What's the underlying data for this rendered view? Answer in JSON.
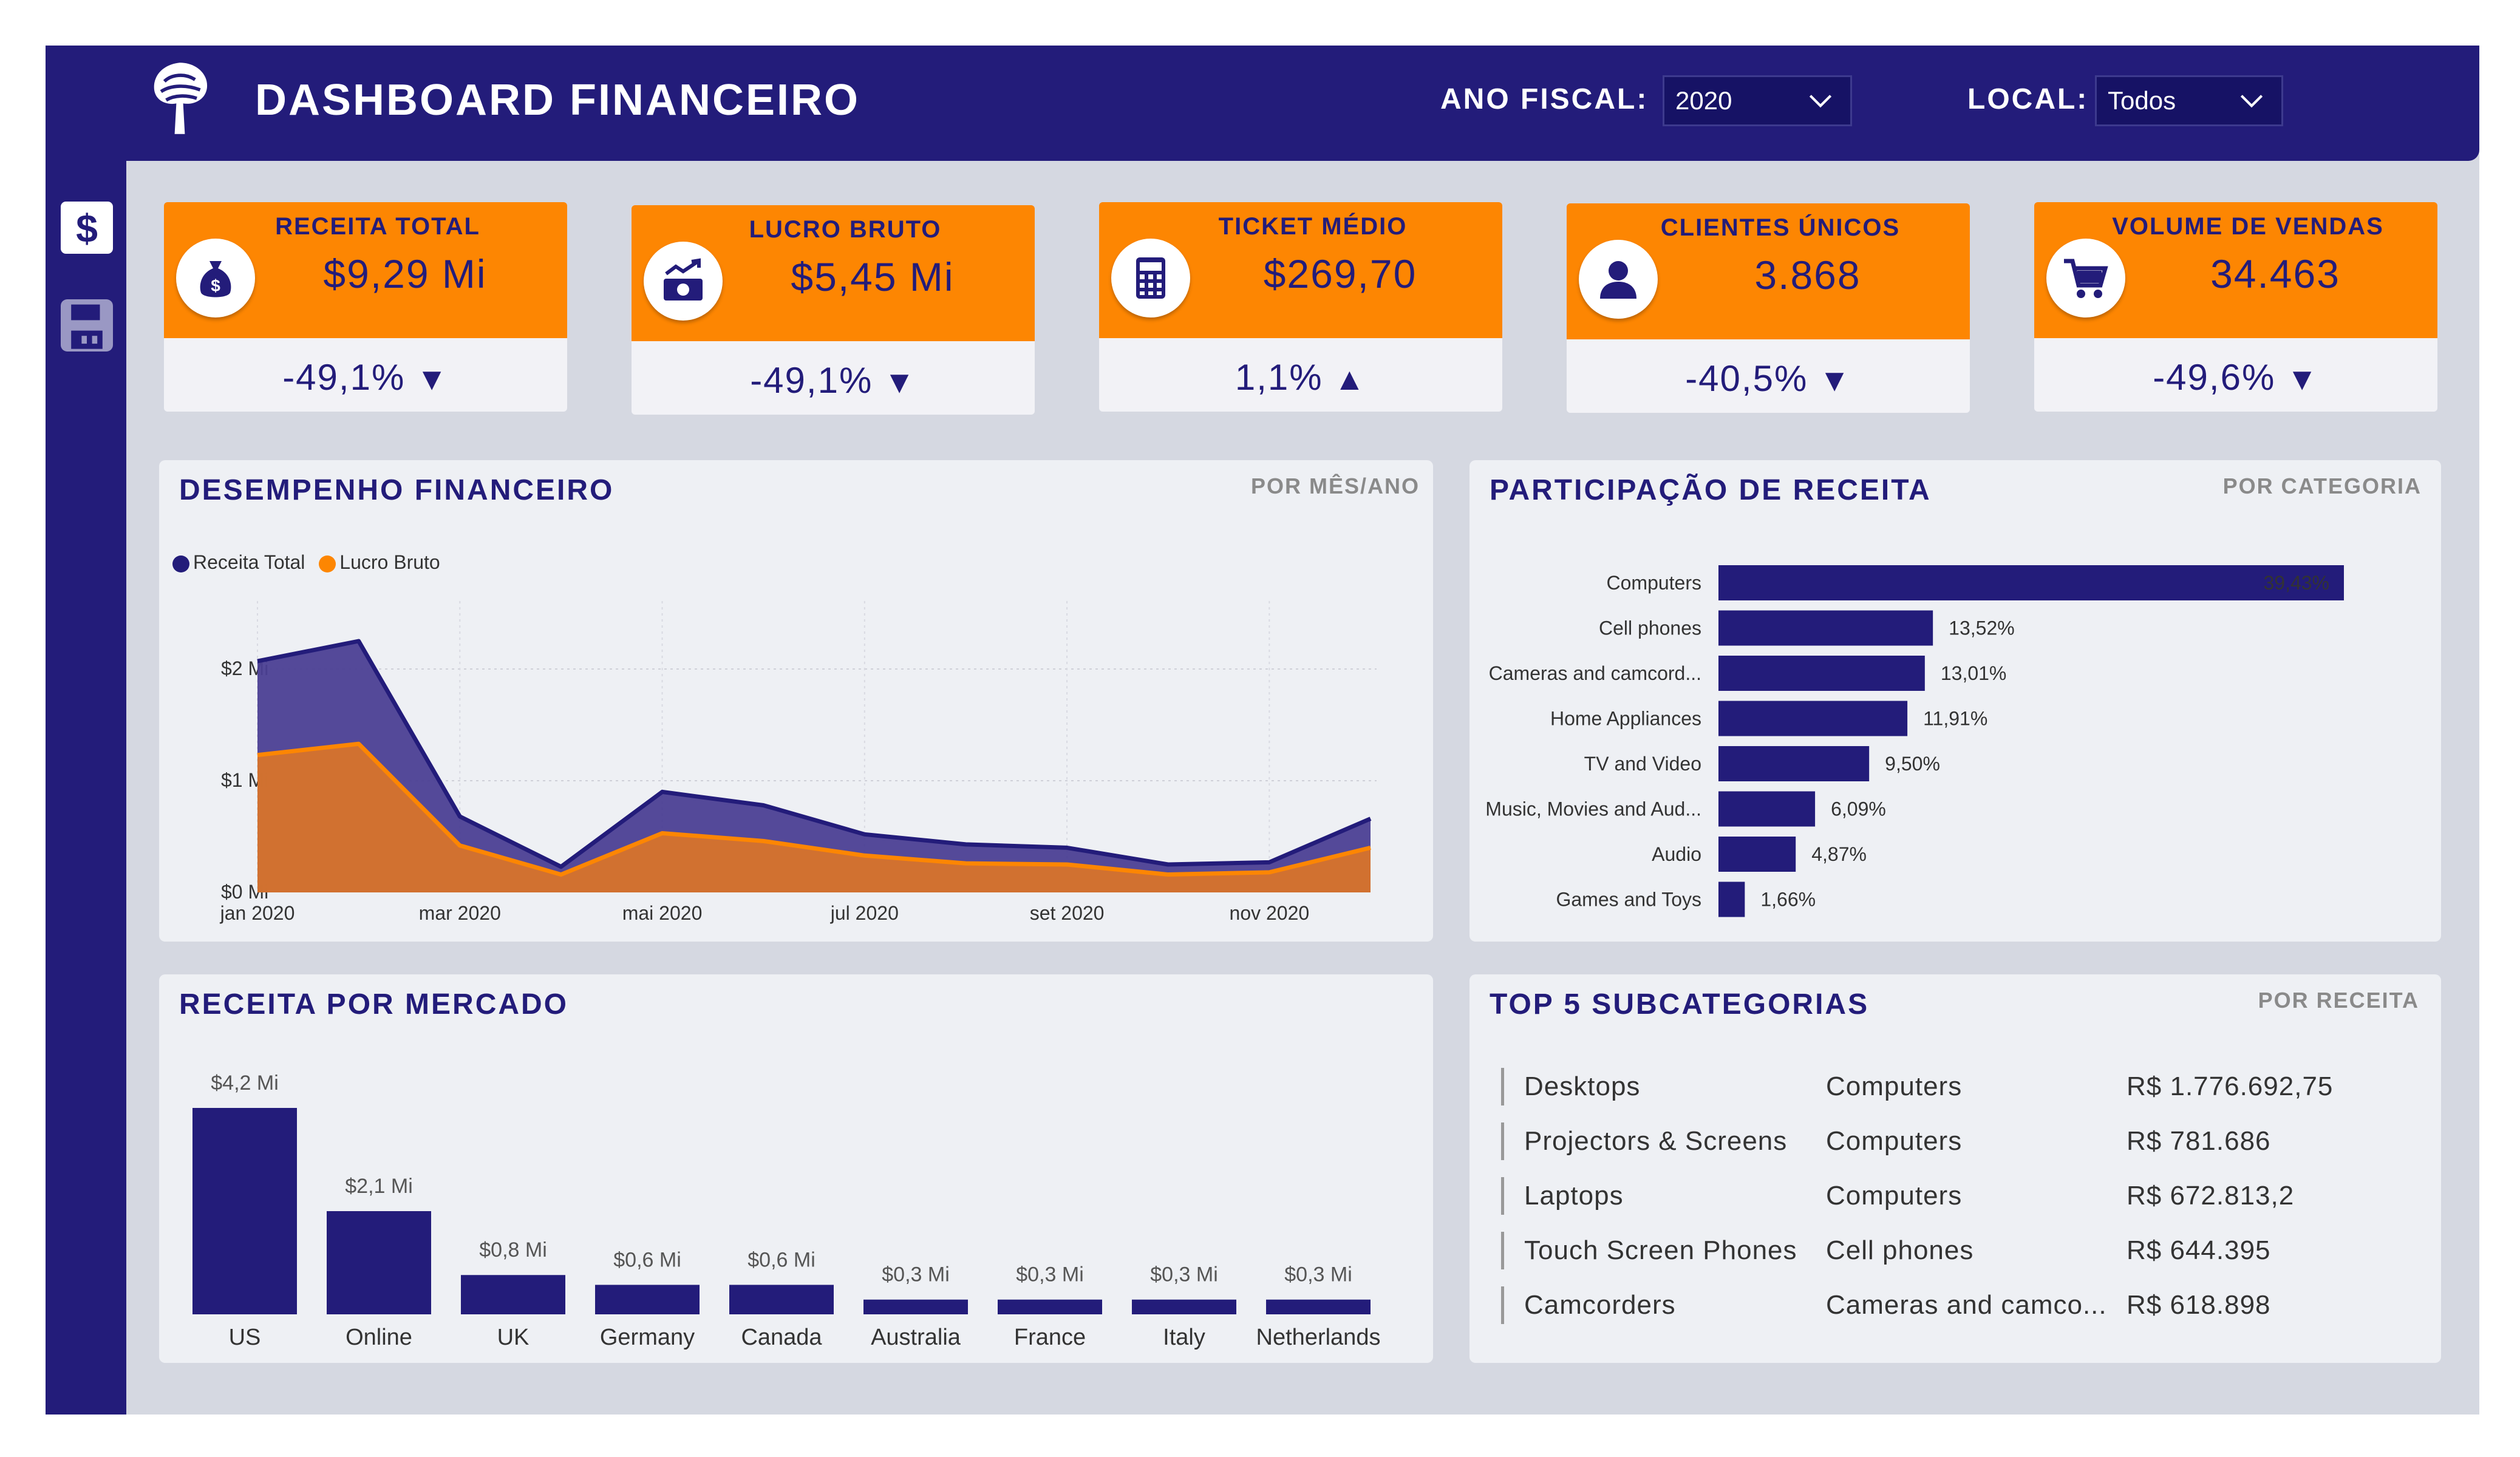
{
  "header": {
    "title": "DASHBOARD FINANCEIRO",
    "fiscal_label": "ANO FISCAL:",
    "fiscal_value": "2020",
    "local_label": "LOCAL:",
    "local_value": "Todos"
  },
  "sidebar": {
    "items": [
      {
        "icon": "dollar-icon"
      },
      {
        "icon": "save-icon"
      }
    ]
  },
  "kpis": [
    {
      "label": "RECEITA TOTAL",
      "value": "$9,29 Mi",
      "delta": "-49,1%",
      "direction": "down",
      "icon": "money-bag-icon"
    },
    {
      "label": "LUCRO BRUTO",
      "value": "$5,45 Mi",
      "delta": "-49,1%",
      "direction": "down",
      "icon": "cash-growth-icon"
    },
    {
      "label": "TICKET MÉDIO",
      "value": "$269,70",
      "delta": "1,1%",
      "direction": "up",
      "icon": "calculator-icon"
    },
    {
      "label": "CLIENTES ÚNICOS",
      "value": "3.868",
      "delta": "-40,5%",
      "direction": "down",
      "icon": "user-icon"
    },
    {
      "label": "VOLUME DE VENDAS",
      "value": "34.463",
      "delta": "-49,6%",
      "direction": "down",
      "icon": "cart-icon"
    }
  ],
  "arrows": {
    "down": "▼",
    "up": "▲"
  },
  "colors": {
    "primary": "#231c7a",
    "accent": "#fd8602",
    "area_primary": "#4b3f94",
    "area_accent": "#d8742a"
  },
  "panels": {
    "desempenho": {
      "title": "DESEMPENHO FINANCEIRO",
      "subtitle": "POR MÊS/ANO"
    },
    "participacao": {
      "title": "PARTICIPAÇÃO DE RECEITA",
      "subtitle": "POR CATEGORIA"
    },
    "mercado": {
      "title": "RECEITA POR MERCADO"
    },
    "top5": {
      "title": "TOP 5 SUBCATEGORIAS",
      "subtitle": "POR RECEITA"
    }
  },
  "chart_data": [
    {
      "type": "area",
      "x": [
        "jan 2020",
        "fev 2020",
        "mar 2020",
        "abr 2020",
        "mai 2020",
        "jun 2020",
        "jul 2020",
        "ago 2020",
        "set 2020",
        "out 2020",
        "nov 2020",
        "dez 2020"
      ],
      "x_tick_labels": [
        "jan 2020",
        "mar 2020",
        "mai 2020",
        "jul 2020",
        "set 2020",
        "nov 2020"
      ],
      "y_tick_labels": [
        "$0 Mi",
        "$1 Mi",
        "$2 Mi"
      ],
      "ylim": [
        0,
        2.5
      ],
      "grid": true,
      "legend": "top-left",
      "series": [
        {
          "name": "Receita Total",
          "values": [
            2.07,
            2.25,
            0.68,
            0.23,
            0.9,
            0.78,
            0.52,
            0.43,
            0.4,
            0.25,
            0.27,
            0.66
          ]
        },
        {
          "name": "Lucro Bruto",
          "values": [
            1.23,
            1.33,
            0.42,
            0.16,
            0.53,
            0.46,
            0.33,
            0.26,
            0.25,
            0.16,
            0.18,
            0.4
          ]
        }
      ]
    },
    {
      "type": "bar",
      "orientation": "horizontal",
      "categories": [
        "Computers",
        "Cell phones",
        "Cameras and camcord...",
        "Home Appliances",
        "TV and Video",
        "Music, Movies and Aud...",
        "Audio",
        "Games and Toys"
      ],
      "values": [
        39.43,
        13.52,
        13.01,
        11.91,
        9.5,
        6.09,
        4.87,
        1.66
      ],
      "data_labels": [
        "39,43%",
        "13,52%",
        "13,01%",
        "11,91%",
        "9,50%",
        "6,09%",
        "4,87%",
        "1,66%"
      ]
    },
    {
      "type": "bar",
      "categories": [
        "US",
        "Online",
        "UK",
        "Germany",
        "Canada",
        "Australia",
        "France",
        "Italy",
        "Netherlands"
      ],
      "values": [
        4.2,
        2.1,
        0.8,
        0.6,
        0.6,
        0.3,
        0.3,
        0.3,
        0.3
      ],
      "data_labels": [
        "$4,2 Mi",
        "$2,1 Mi",
        "$0,8 Mi",
        "$0,6 Mi",
        "$0,6 Mi",
        "$0,3 Mi",
        "$0,3 Mi",
        "$0,3 Mi",
        "$0,3 Mi"
      ]
    }
  ],
  "top5": [
    {
      "sub": "Desktops",
      "cat": "Computers",
      "value": "R$ 1.776.692,75"
    },
    {
      "sub": "Projectors & Screens",
      "cat": "Computers",
      "value": "R$ 781.686"
    },
    {
      "sub": "Laptops",
      "cat": "Computers",
      "value": "R$ 672.813,2"
    },
    {
      "sub": "Touch Screen Phones",
      "cat": "Cell phones",
      "value": "R$ 644.395"
    },
    {
      "sub": "Camcorders",
      "cat": "Cameras and camco...",
      "value": "R$ 618.898"
    }
  ]
}
